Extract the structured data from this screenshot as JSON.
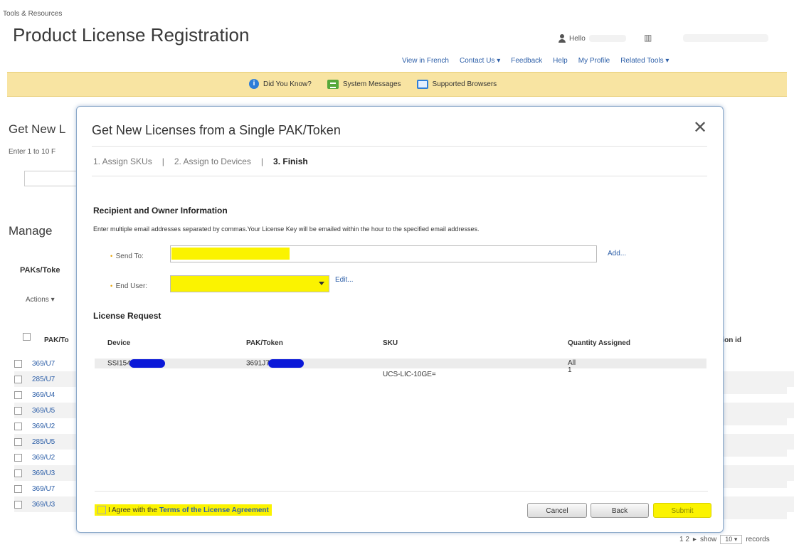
{
  "header": {
    "breadcrumb": "Tools & Resources",
    "title": "Product License Registration",
    "hello": "Hello",
    "links": [
      "View in French",
      "Contact Us ▾",
      "Feedback",
      "Help",
      "My Profile",
      "Related Tools ▾"
    ]
  },
  "banner": {
    "did_you_know": "Did You Know?",
    "system_messages": "System Messages",
    "supported_browsers": "Supported Browsers"
  },
  "background": {
    "get_new_heading": "Get New L",
    "enter_text": "Enter 1 to 10 F",
    "manage_heading": "Manage",
    "paks_tab": "PAKs/Toke",
    "actions_label": "Actions ▾",
    "col_pak": "PAK/To",
    "col_id": "tion id",
    "rows": [
      "369/U7",
      "285/U7",
      "369/U4",
      "369/U5",
      "369/U2",
      "285/U5",
      "369/U2",
      "369/U3",
      "369/U7",
      "369/U3"
    ],
    "pager": {
      "pages": "1 2",
      "next": "▸",
      "show_label": "show",
      "show_value": "10",
      "records_label": "records"
    }
  },
  "modal": {
    "title": "Get New Licenses from a Single PAK/Token",
    "steps": [
      "1. Assign SKUs",
      "|",
      "2. Assign to Devices",
      "|",
      "3. Finish"
    ],
    "recipient_heading": "Recipient and Owner Information",
    "help_text": "Enter multiple email addresses separated by commas.Your License Key will be emailed within the hour to the specified email addresses.",
    "send_to_label": "Send To:",
    "send_to_value": "",
    "add_link": "Add...",
    "end_user_label": "End User:",
    "end_user_value": "",
    "edit_link": "Edit...",
    "license_heading": "License Request",
    "table": {
      "headers": [
        "Device",
        "PAK/Token",
        "SKU",
        "Quantity Assigned"
      ],
      "rows": [
        {
          "device": "SSI154",
          "pak": "3691J7",
          "sku": "UCS-LIC-10GE=",
          "qty": [
            "All",
            "1"
          ]
        }
      ]
    },
    "agree_prefix": "I Agree with the",
    "agree_terms": "Terms of the License Agreement",
    "cancel_label": "Cancel",
    "back_label": "Back",
    "submit_label": "Submit",
    "close_glyph": "✕"
  },
  "colors": {
    "banner": "#f8e4a2",
    "highlight": "#fbf300",
    "link": "#2d5fa8",
    "redaction": "#0a18d8"
  },
  "icons": [
    "person-icon",
    "organization-icon",
    "info-icon",
    "message-icon",
    "browser-icon",
    "close-icon",
    "dropdown-arrow-icon"
  ]
}
